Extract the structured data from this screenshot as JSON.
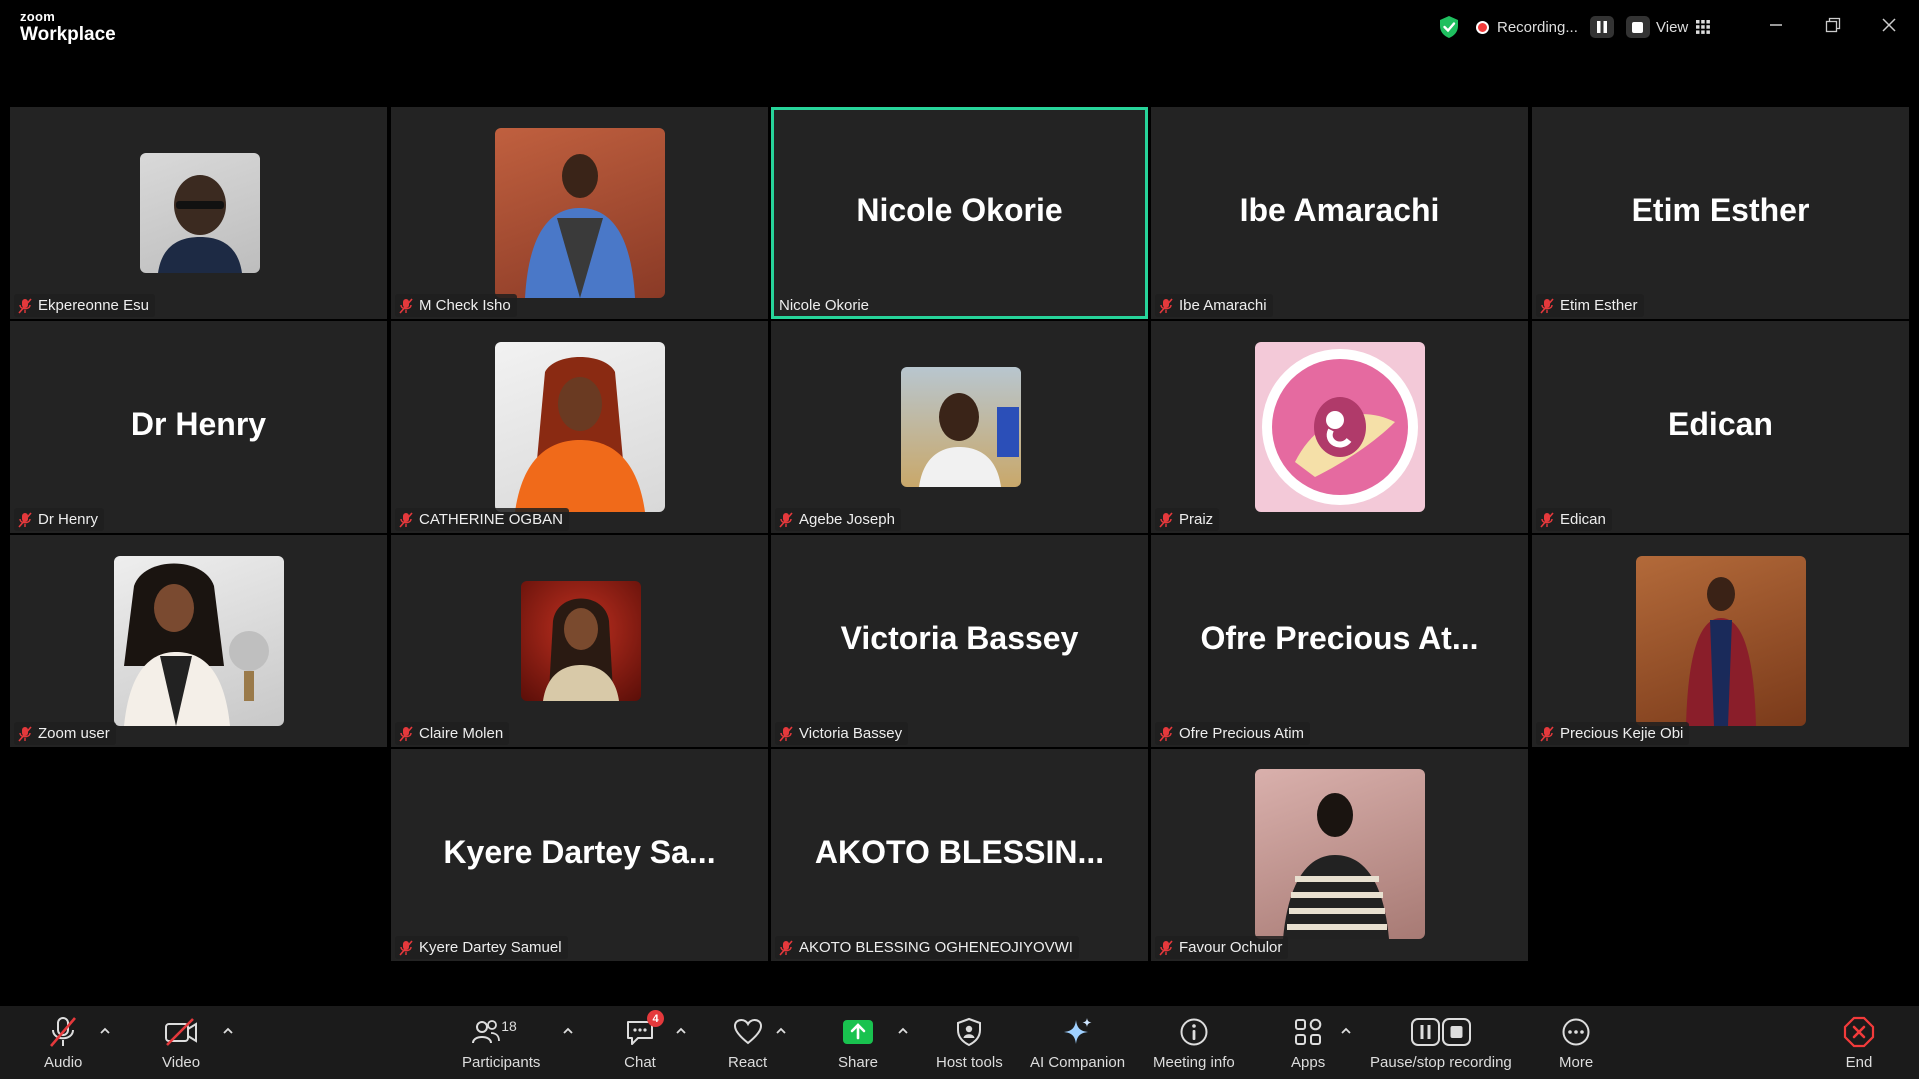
{
  "window": {
    "brand_small": "zoom",
    "brand_big": "Workplace",
    "recording_label": "Recording...",
    "view_label": "View",
    "accent_color": "#27d49a",
    "record_color": "#f23b3b"
  },
  "tiles": [
    {
      "name": "Ekpereonne Esu",
      "big": ""
    },
    {
      "name": "M Check Isho",
      "big": ""
    },
    {
      "name": "Nicole Okorie",
      "big": "Nicole Okorie"
    },
    {
      "name": "Ibe Amarachi",
      "big": "Ibe Amarachi"
    },
    {
      "name": "Etim Esther",
      "big": "Etim Esther"
    },
    {
      "name": "Dr Henry",
      "big": "Dr Henry"
    },
    {
      "name": "CATHERINE OGBAN",
      "big": ""
    },
    {
      "name": "Agebe Joseph",
      "big": ""
    },
    {
      "name": "Praiz",
      "big": ""
    },
    {
      "name": "Edican",
      "big": "Edican"
    },
    {
      "name": "Zoom user",
      "big": ""
    },
    {
      "name": "Claire Molen",
      "big": ""
    },
    {
      "name": "Victoria Bassey",
      "big": "Victoria Bassey"
    },
    {
      "name": "Ofre Precious Atim",
      "big": "Ofre  Precious  At..."
    },
    {
      "name": "Precious Kejie Obi",
      "big": ""
    },
    {
      "name": "Kyere Dartey Samuel",
      "big": "Kyere  Dartey  Sa..."
    },
    {
      "name": "AKOTO BLESSING OGHENEOJIYOVWI",
      "big": "AKOTO  BLESSIN..."
    },
    {
      "name": "Favour Ochulor",
      "big": ""
    }
  ],
  "toolbar": {
    "audio": "Audio",
    "video": "Video",
    "participants": "Participants",
    "participants_count": "18",
    "chat": "Chat",
    "chat_badge": "4",
    "react": "React",
    "share": "Share",
    "host_tools": "Host tools",
    "ai_companion": "AI Companion",
    "meeting_info": "Meeting info",
    "apps": "Apps",
    "pause_stop_recording": "Pause/stop recording",
    "more": "More",
    "end": "End"
  }
}
